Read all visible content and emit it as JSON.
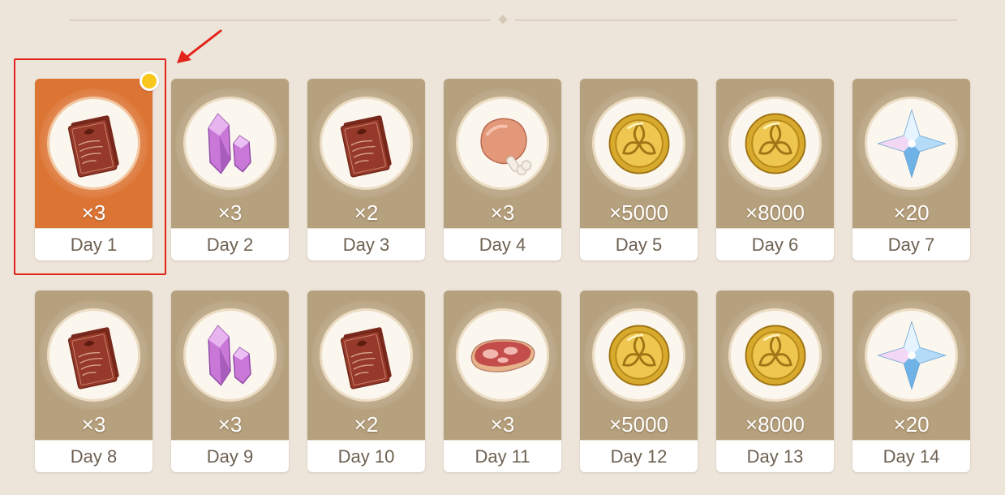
{
  "rewards": [
    {
      "day": "Day 1",
      "qty": "×3",
      "item": "character-exp-book-icon",
      "claimable": true
    },
    {
      "day": "Day 2",
      "qty": "×3",
      "item": "enhancement-ore-icon",
      "claimable": false
    },
    {
      "day": "Day 3",
      "qty": "×2",
      "item": "character-exp-book-icon",
      "claimable": false
    },
    {
      "day": "Day 4",
      "qty": "×3",
      "item": "fowl-meat-icon",
      "claimable": false
    },
    {
      "day": "Day 5",
      "qty": "×5000",
      "item": "mora-coin-icon",
      "claimable": false
    },
    {
      "day": "Day 6",
      "qty": "×8000",
      "item": "mora-coin-icon",
      "claimable": false
    },
    {
      "day": "Day 7",
      "qty": "×20",
      "item": "primogem-icon",
      "claimable": false
    },
    {
      "day": "Day 8",
      "qty": "×3",
      "item": "character-exp-book-icon",
      "claimable": false
    },
    {
      "day": "Day 9",
      "qty": "×3",
      "item": "enhancement-ore-icon",
      "claimable": false
    },
    {
      "day": "Day 10",
      "qty": "×2",
      "item": "character-exp-book-icon",
      "claimable": false
    },
    {
      "day": "Day 11",
      "qty": "×3",
      "item": "raw-meat-icon",
      "claimable": false
    },
    {
      "day": "Day 12",
      "qty": "×5000",
      "item": "mora-coin-icon",
      "claimable": false
    },
    {
      "day": "Day 13",
      "qty": "×8000",
      "item": "mora-coin-icon",
      "claimable": false
    },
    {
      "day": "Day 14",
      "qty": "×20",
      "item": "primogem-icon",
      "claimable": false
    }
  ],
  "colors": {
    "background": "#ede5da",
    "card": "#b6a17e",
    "card_active": "#dc7434",
    "highlight_box": "#e2231a",
    "status_dot": "#f9c71b"
  }
}
